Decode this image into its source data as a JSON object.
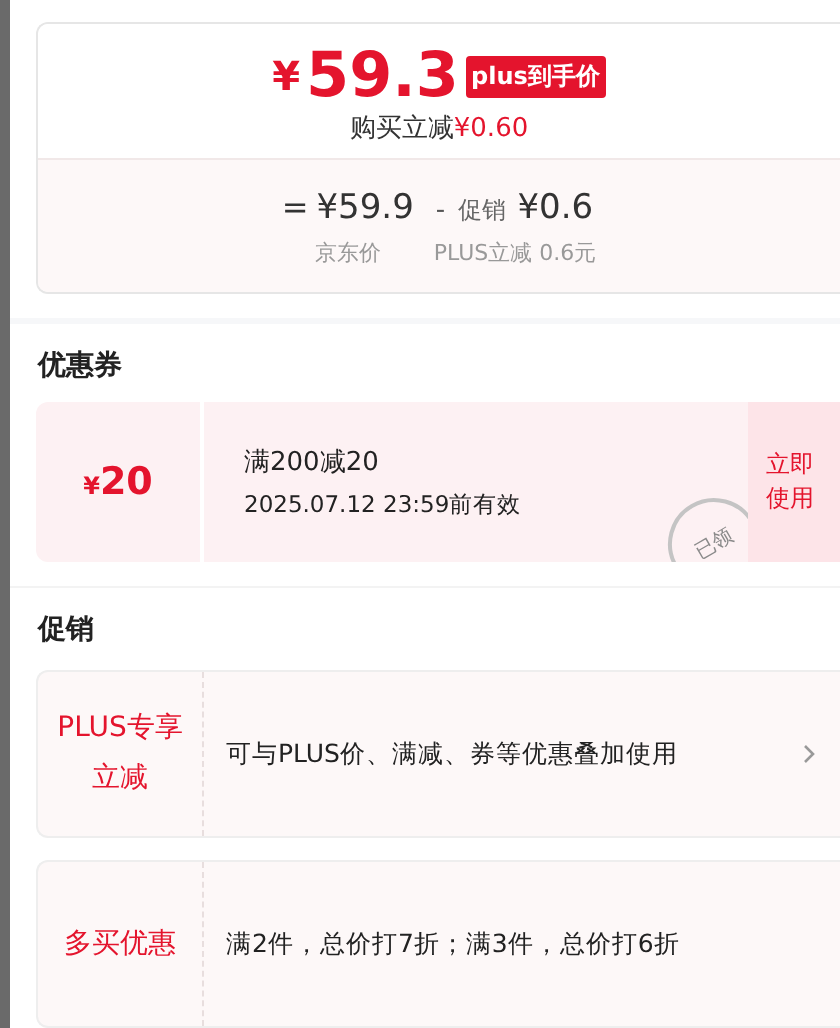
{
  "price_card": {
    "currency": "¥",
    "final_price": "59.3",
    "badge": "plus到手价",
    "saving_label": "购买立减",
    "saving_amount": "¥0.60",
    "breakdown": [
      {
        "kind": "equals",
        "symbol": "=",
        "amount": "¥59.9",
        "caption": "京东价"
      },
      {
        "kind": "minus",
        "symbol": "-",
        "label": "促销",
        "amount": "¥0.6",
        "caption": "PLUS立减 0.6元"
      }
    ]
  },
  "coupons": {
    "title": "优惠券",
    "items": [
      {
        "currency": "¥",
        "amount": "20",
        "condition": "满200减20",
        "validity": "2025.07.12 23:59前有效",
        "claimed": true,
        "stamp": "已领",
        "action": "立即使用"
      }
    ]
  },
  "promotions": {
    "title": "促销",
    "items": [
      {
        "tag": "PLUS专享立减",
        "description": "可与PLUS价、满减、券等优惠叠加使用",
        "has_arrow": true
      },
      {
        "tag": "多买优惠",
        "description": "满2件，总价打7折；满3件，总价打6折",
        "has_arrow": false
      }
    ]
  }
}
